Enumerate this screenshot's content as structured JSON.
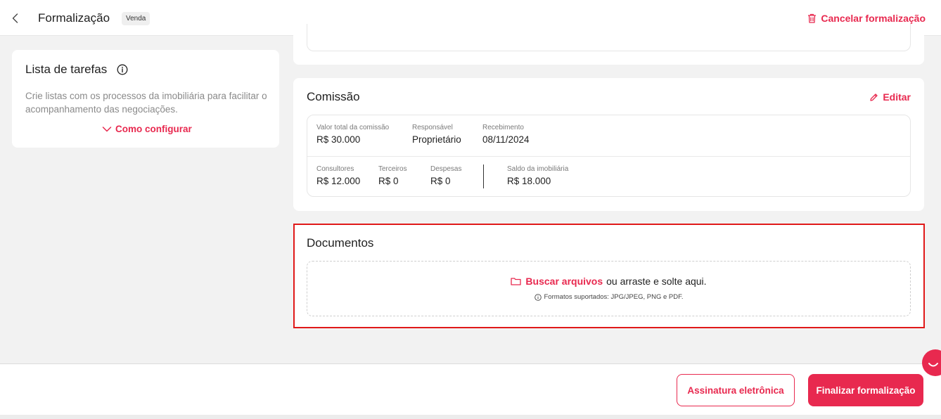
{
  "header": {
    "title": "Formalização",
    "badge": "Venda",
    "cancel_label": "Cancelar formalização"
  },
  "tasks": {
    "title": "Lista de tarefas",
    "description": "Crie listas com os processos da imobiliária para facilitar o acompanhamento das negociações.",
    "how_to_label": "Como configurar"
  },
  "commission": {
    "title": "Comissão",
    "edit_label": "Editar",
    "total_label": "Valor total da comissão",
    "total_value": "R$ 30.000",
    "responsible_label": "Responsável",
    "responsible_value": "Proprietário",
    "receipt_label": "Recebimento",
    "receipt_value": "08/11/2024",
    "consultants_label": "Consultores",
    "consultants_value": "R$ 12.000",
    "third_label": "Terceiros",
    "third_value": "R$ 0",
    "expenses_label": "Despesas",
    "expenses_value": "R$ 0",
    "balance_label": "Saldo da imobiliária",
    "balance_value": "R$ 18.000"
  },
  "documents": {
    "title": "Documentos",
    "browse_label": "Buscar arquivos",
    "drop_text": "ou arraste e solte aqui.",
    "formats_text": "Formatos suportados: JPG/JPEG, PNG e PDF."
  },
  "footer": {
    "esign_label": "Assinatura eletrônica",
    "finish_label": "Finalizar formalização"
  },
  "colors": {
    "accent": "#e8294f",
    "highlight_border": "#e01919",
    "background": "#f2f2f2"
  },
  "icons": [
    "chevron-left-icon",
    "trash-icon",
    "info-icon",
    "chevron-down-icon",
    "pencil-icon",
    "folder-icon",
    "chat-icon"
  ]
}
